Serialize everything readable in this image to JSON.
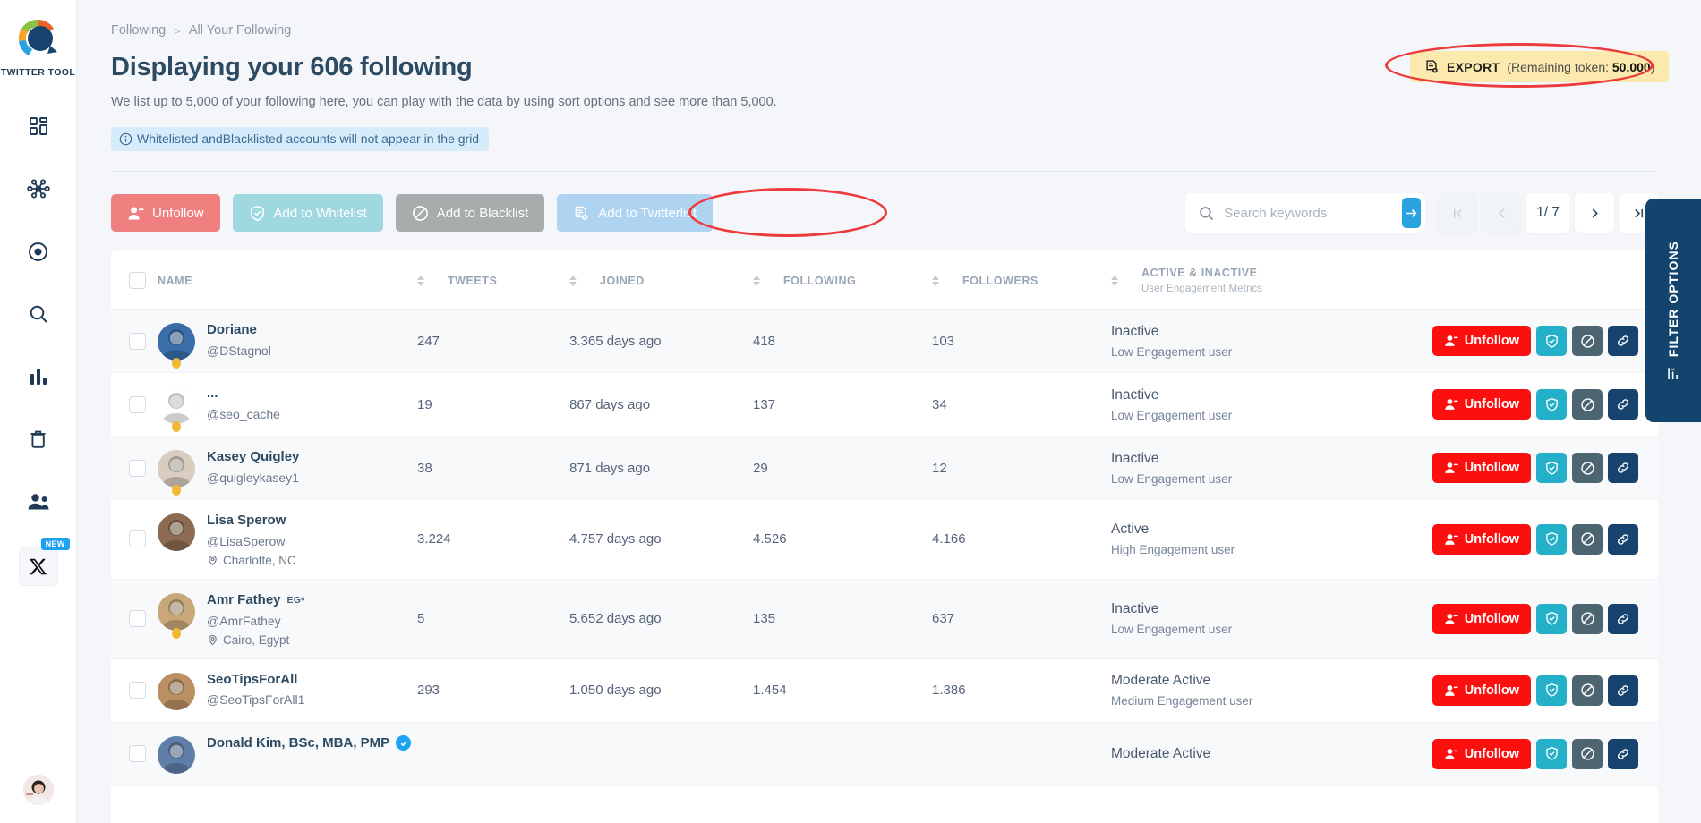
{
  "sidebar": {
    "logo_label": "TWITTER TOOL",
    "items": [
      {
        "name": "dashboard",
        "icon": "dashboard-icon"
      },
      {
        "name": "network",
        "icon": "network-icon"
      },
      {
        "name": "target",
        "icon": "target-icon"
      },
      {
        "name": "search",
        "icon": "search-icon"
      },
      {
        "name": "analytics",
        "icon": "bar-chart-icon"
      },
      {
        "name": "trash",
        "icon": "trash-icon"
      },
      {
        "name": "users",
        "icon": "users-icon"
      }
    ],
    "x_item": {
      "icon": "x-logo-icon",
      "badge": "NEW"
    },
    "avatar_alt": "user-avatar"
  },
  "header": {
    "breadcrumb": {
      "parent": "Following",
      "separator": ">",
      "current": "All Your Following"
    },
    "title": "Displaying your 606 following",
    "subtitle": "We list up to 5,000 of your following here, you can play with the data by using sort options and see more than 5,000.",
    "info_banner": "Whitelisted andBlacklisted accounts will not appear in the grid",
    "info_icon": "info-icon"
  },
  "export": {
    "icon": "export-document-icon",
    "label": "EXPORT",
    "token_prefix": "(Remaining token: ",
    "token_value": "50.000",
    "token_suffix": ")",
    "highlight_color": "#ee3a3a",
    "bg_color": "#fce9ae"
  },
  "toolbar": {
    "buttons": [
      {
        "label": "Unfollow",
        "icon": "user-minus-icon",
        "color": "#f08080"
      },
      {
        "label": "Add to Whitelist",
        "icon": "shield-check-icon",
        "color": "#9fd9df"
      },
      {
        "label": "Add to Blacklist",
        "icon": "ban-icon",
        "color": "#a7acad"
      },
      {
        "label": "Add to Twitterlist",
        "icon": "list-add-icon",
        "color": "#aed4f2"
      }
    ],
    "highlighted_index": 3
  },
  "search": {
    "placeholder": "Search keywords",
    "value": "",
    "icon": "search-icon",
    "submit_icon": "arrow-right-icon"
  },
  "pagination": {
    "first_icon": "first-page-icon",
    "prev_icon": "chevron-left-icon",
    "current": "1",
    "separator": "/",
    "total": "7",
    "label": "1/ 7",
    "next_icon": "chevron-right-icon",
    "last_icon": "last-page-icon",
    "first_disabled": true,
    "prev_disabled": true
  },
  "filter_tab": {
    "label": "FILTER OPTIONS",
    "icon": "filter-icon"
  },
  "table": {
    "columns": [
      {
        "key": "checkbox",
        "label": ""
      },
      {
        "key": "name",
        "label": "NAME",
        "sortable": true
      },
      {
        "key": "tweets",
        "label": "TWEETS",
        "sortable": true
      },
      {
        "key": "joined",
        "label": "JOINED",
        "sortable": true
      },
      {
        "key": "following",
        "label": "FOLLOWING",
        "sortable": true
      },
      {
        "key": "followers",
        "label": "FOLLOWERS",
        "sortable": true
      },
      {
        "key": "engagement",
        "label": "ACTIVE & INACTIVE",
        "sublabel": "User Engagement Metrics"
      },
      {
        "key": "actions",
        "label": ""
      }
    ],
    "row_actions": {
      "unfollow_label": "Unfollow",
      "unfollow_icon": "user-minus-icon",
      "whitelist_icon": "shield-check-icon",
      "blacklist_icon": "ban-icon",
      "link_icon": "link-icon"
    },
    "rows": [
      {
        "name": "Doriane",
        "name_suffix": "",
        "handle": "@DStagnol",
        "location": "",
        "verified": false,
        "status_dot": true,
        "avatar_color": "#3a6ea8",
        "tweets": "247",
        "joined": "3.365 days ago",
        "following": "418",
        "followers": "103",
        "engagement_status": "Inactive",
        "engagement_detail": "Low Engagement user"
      },
      {
        "name": "...",
        "name_suffix": "",
        "handle": "@seo_cache",
        "location": "",
        "verified": false,
        "status_dot": true,
        "avatar_color": "#ffffff",
        "tweets": "19",
        "joined": "867 days ago",
        "following": "137",
        "followers": "34",
        "engagement_status": "Inactive",
        "engagement_detail": "Low Engagement user"
      },
      {
        "name": "Kasey Quigley",
        "name_suffix": "",
        "handle": "@quigleykasey1",
        "location": "",
        "verified": false,
        "status_dot": true,
        "avatar_color": "#d8cdbe",
        "tweets": "38",
        "joined": "871 days ago",
        "following": "29",
        "followers": "12",
        "engagement_status": "Inactive",
        "engagement_detail": "Low Engagement user"
      },
      {
        "name": "Lisa Sperow",
        "name_suffix": "",
        "handle": "@LisaSperow",
        "location": "Charlotte, NC",
        "verified": false,
        "status_dot": false,
        "avatar_color": "#8d6b52",
        "tweets": "3.224",
        "joined": "4.757 days ago",
        "following": "4.526",
        "followers": "4.166",
        "engagement_status": "Active",
        "engagement_detail": "High Engagement user"
      },
      {
        "name": "Amr Fathey",
        "name_suffix": "EGᵒ",
        "handle": "@AmrFathey",
        "location": "Cairo, Egypt",
        "verified": false,
        "status_dot": true,
        "avatar_color": "#c8a87a",
        "tweets": "5",
        "joined": "5.652 days ago",
        "following": "135",
        "followers": "637",
        "engagement_status": "Inactive",
        "engagement_detail": "Low Engagement user"
      },
      {
        "name": "SeoTipsForAll",
        "name_suffix": "",
        "handle": "@SeoTipsForAll1",
        "location": "",
        "verified": false,
        "status_dot": false,
        "avatar_color": "#b98f63",
        "tweets": "293",
        "joined": "1.050 days ago",
        "following": "1.454",
        "followers": "1.386",
        "engagement_status": "Moderate Active",
        "engagement_detail": "Medium Engagement user"
      },
      {
        "name": "Donald Kim, BSc, MBA, PMP",
        "name_suffix": "",
        "handle": "",
        "location": "",
        "verified": true,
        "status_dot": false,
        "avatar_color": "#5f7ea8",
        "tweets": "",
        "joined": "",
        "following": "",
        "followers": "",
        "engagement_status": "Moderate Active",
        "engagement_detail": ""
      }
    ]
  }
}
